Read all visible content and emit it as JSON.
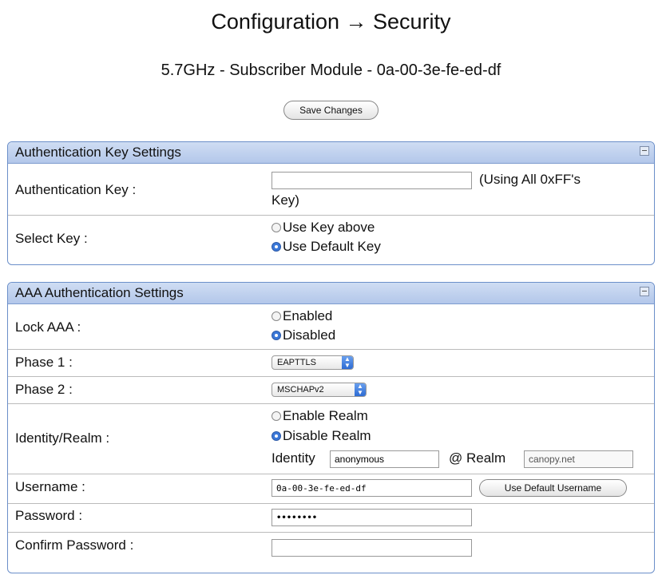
{
  "page": {
    "title": "Configuration → Security",
    "subtitle": "5.7GHz - Subscriber Module - 0a-00-3e-fe-ed-df",
    "save_label": "Save Changes"
  },
  "auth_key_panel": {
    "title": "Authentication Key Settings",
    "auth_key_label": "Authentication Key :",
    "auth_key_value": "",
    "auth_key_note_1": "(Using All 0xFF's",
    "auth_key_note_2": "Key)",
    "select_key_label": "Select Key :",
    "option_use_above": "Use Key above",
    "option_use_default": "Use Default Key",
    "selected_key_option": "Use Default Key"
  },
  "aaa_panel": {
    "title": "AAA Authentication Settings",
    "lock_label": "Lock AAA :",
    "lock_enabled": "Enabled",
    "lock_disabled": "Disabled",
    "lock_selected": "Disabled",
    "phase1_label": "Phase 1 :",
    "phase1_value": "EAPTTLS",
    "phase2_label": "Phase 2 :",
    "phase2_value": "MSCHAPv2",
    "identity_realm_label": "Identity/Realm :",
    "enable_realm": "Enable Realm",
    "disable_realm": "Disable Realm",
    "realm_selected": "Disable Realm",
    "identity_label": "Identity",
    "identity_value": "anonymous",
    "realm_label": "@ Realm",
    "realm_value": "canopy.net",
    "username_label": "Username :",
    "username_value": "0a-00-3e-fe-ed-df",
    "default_username_label": "Use Default Username",
    "password_label": "Password :",
    "password_value": "••••••••",
    "confirm_label": "Confirm Password :",
    "confirm_value": ""
  }
}
